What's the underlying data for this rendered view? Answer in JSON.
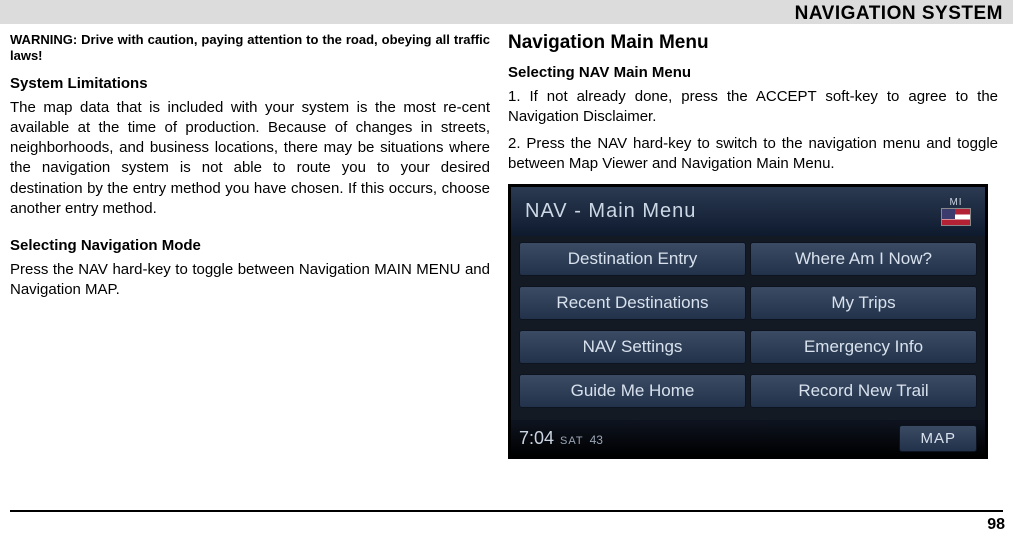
{
  "header": {
    "title": "NAVIGATION SYSTEM"
  },
  "left": {
    "warning": "WARNING: Drive with caution, paying attention to the road, obeying all traffic laws!",
    "limitations_heading": "System Limitations",
    "limitations_body": "The map data that is included with your system is the most re-cent available at the time of production. Because of changes in streets, neighborhoods, and business locations, there may be situations where the navigation system is not able to route you to your desired destination by the entry method you have chosen. If this occurs, choose another entry method.",
    "selecting_mode_heading": "Selecting Navigation Mode",
    "selecting_mode_body": "Press the NAV hard-key to toggle between Navigation MAIN MENU and Navigation MAP."
  },
  "right": {
    "main_heading": "Navigation Main Menu",
    "sub_heading": "Selecting NAV Main Menu",
    "step1": "1. If not already done, press the ACCEPT soft-key to agree to the Navigation Disclaimer.",
    "step2": "2. Press the NAV hard-key to switch to the navigation menu and toggle between Map Viewer and Navigation Main Menu."
  },
  "screenshot": {
    "title": "NAV - Main Menu",
    "flag_label": "MI",
    "buttons": [
      "Destination Entry",
      "Where Am I Now?",
      "Recent Destinations",
      "My Trips",
      "NAV Settings",
      "Emergency Info",
      "Guide Me Home",
      "Record New Trail"
    ],
    "time": "7:04",
    "sat": "SAT",
    "satnum": "43",
    "map": "MAP"
  },
  "page_number": "98"
}
